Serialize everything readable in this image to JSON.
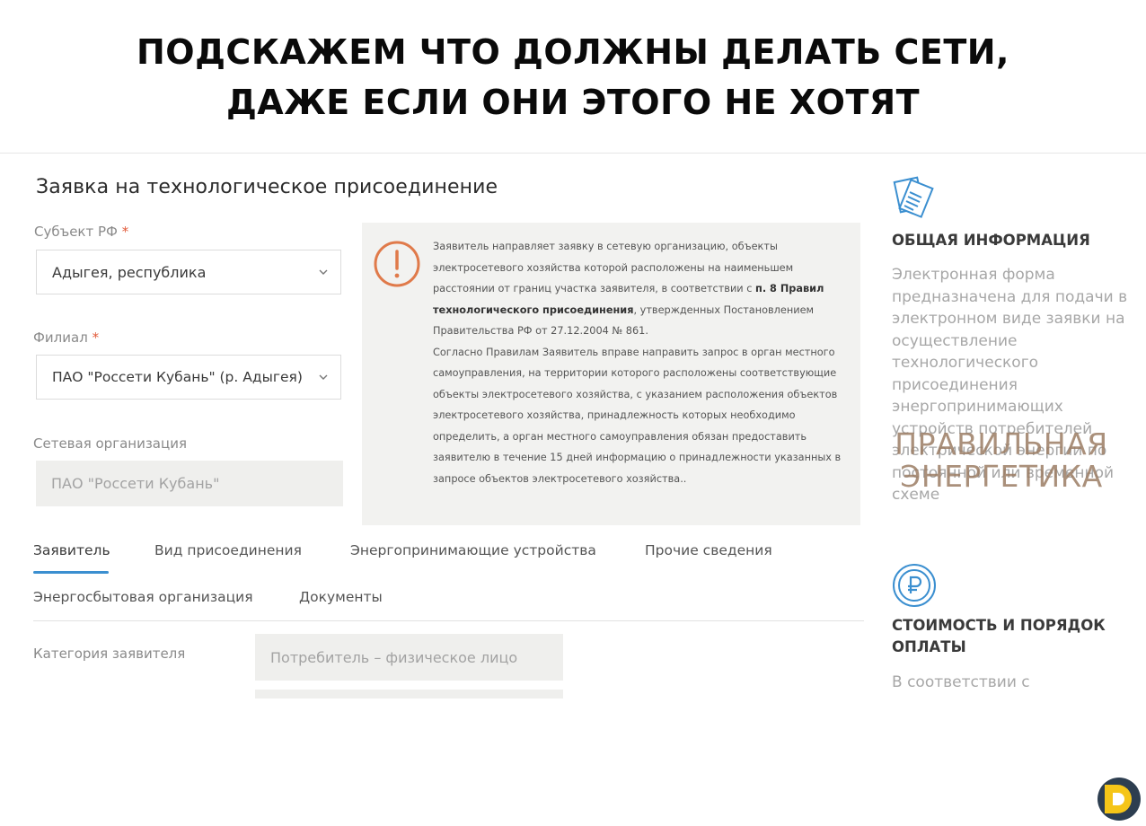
{
  "headline": {
    "line1": "ПОДСКАЖЕМ ЧТО ДОЛЖНЫ ДЕЛАТЬ СЕТИ,",
    "line2": "ДАЖЕ ЕСЛИ ОНИ ЭТОГО НЕ ХОТЯТ"
  },
  "form": {
    "title": "Заявка на технологическое присоединение",
    "subject": {
      "label": "Субъект РФ",
      "required_mark": "*",
      "value": "Адыгея, республика"
    },
    "branch": {
      "label": "Филиал",
      "required_mark": "*",
      "value": "ПАО \"Россети Кубань\" (р. Адыгея)"
    },
    "network_org": {
      "label": "Сетевая организация",
      "value": "ПАО \"Россети Кубань\""
    },
    "category": {
      "label": "Категория заявителя",
      "value": "Потребитель – физическое лицо"
    }
  },
  "notice": {
    "part1": "Заявитель направляет заявку в сетевую организацию, объекты электросетевого хозяйства которой расположены на наименьшем расстоянии от границ участка заявителя, в соответствии с ",
    "bold": "п. 8 Правил технологического присоединения",
    "part2": ", утвержденных Постановлением Правительства РФ от 27.12.2004 № 861.",
    "para2": "Согласно Правилам Заявитель вправе направить запрос в орган местного самоуправления, на территории которого расположены соответствующие объекты электросетевого хозяйства, с указанием расположения объектов электросетевого хозяйства, принадлежность которых необходимо определить, а орган местного самоуправления обязан предоставить заявителю в течение 15 дней информацию о принадлежности указанных в запросе объектов электросетевого хозяйства.."
  },
  "tabs": [
    {
      "label": "Заявитель",
      "active": true
    },
    {
      "label": "Вид присоединения",
      "active": false
    },
    {
      "label": "Энергопринимающие устройства",
      "active": false
    },
    {
      "label": "Прочие сведения",
      "active": false
    },
    {
      "label": "Энергосбытовая организация",
      "active": false
    },
    {
      "label": "Документы",
      "active": false
    }
  ],
  "sidebar": {
    "general": {
      "icon": "documents-icon",
      "heading": "ОБЩАЯ ИНФОРМАЦИЯ",
      "text": "Электронная форма предназначена для подачи в электронном виде заявки на осуществление технологического присоединения энергопринимающих устройств потребителей электрической энергии по постоянной или временной схеме"
    },
    "cost": {
      "icon": "ruble-icon",
      "heading_line1": "СТОИМОСТЬ И ПОРЯДОК",
      "heading_line2": "ОПЛАТЫ",
      "text": "В соответствии с"
    }
  },
  "watermark": {
    "line1": "ПРАВИЛЬНАЯ",
    "line2": "ЭНЕРГЕТИКА"
  },
  "colors": {
    "accent_tab": "#3b8fd0",
    "notice_icon": "#e07a4a",
    "sidebar_icon": "#3b8fd0",
    "logo_dark": "#2d3e50",
    "logo_yellow": "#f5c518"
  }
}
